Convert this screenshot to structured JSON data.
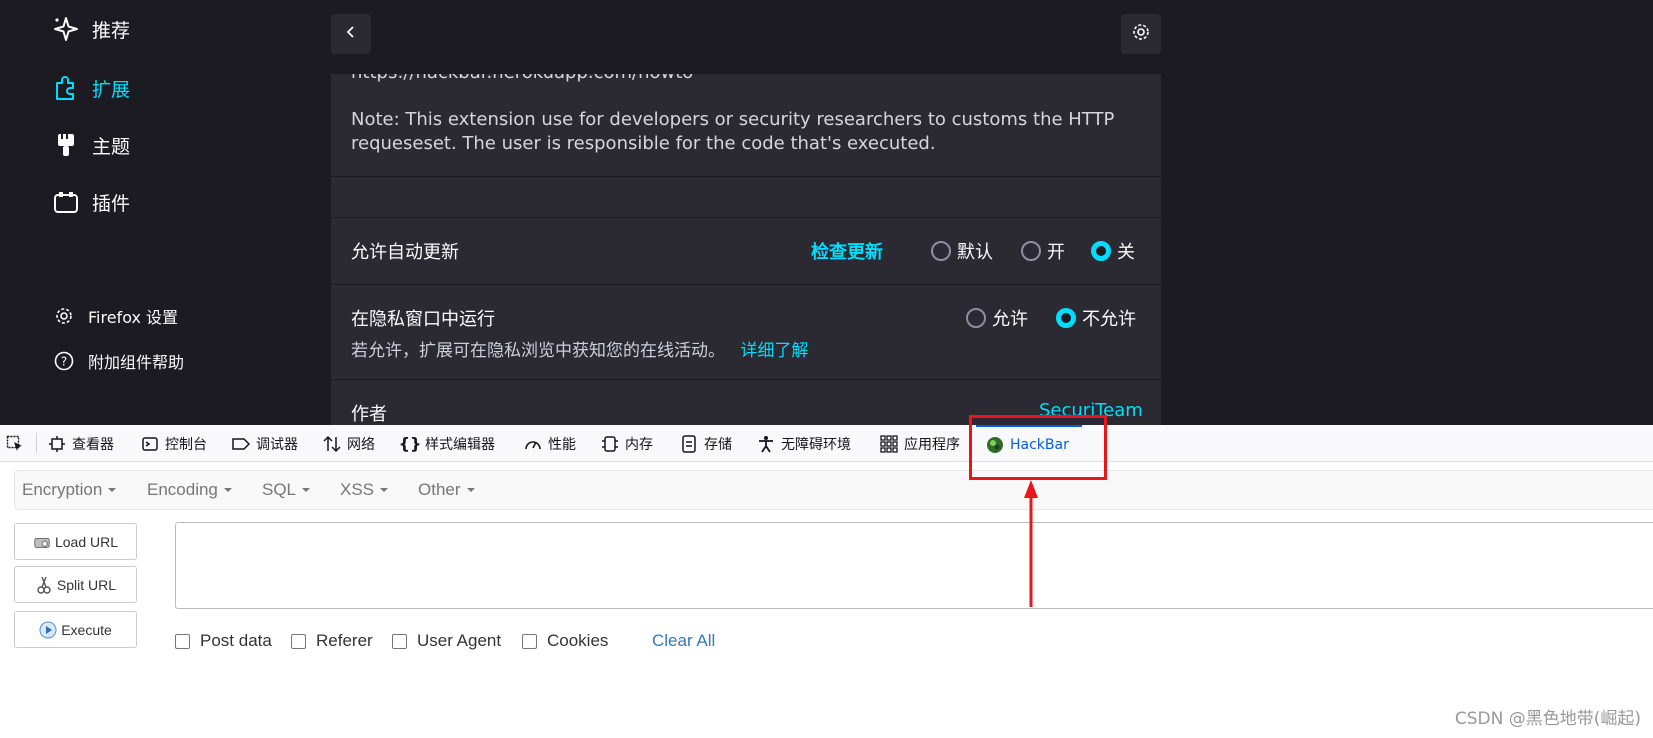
{
  "sidebar": {
    "items": [
      {
        "label": "推荐",
        "icon": "sparkle-icon"
      },
      {
        "label": "扩展",
        "icon": "puzzle-icon",
        "active": true
      },
      {
        "label": "主题",
        "icon": "brush-icon"
      },
      {
        "label": "插件",
        "icon": "plugin-icon"
      }
    ],
    "footer": [
      {
        "label": "Firefox 设置",
        "icon": "gear-icon"
      },
      {
        "label": "附加组件帮助",
        "icon": "help-icon"
      }
    ]
  },
  "addon_detail": {
    "homepage_url": "https://hackbar.herokuapp.com/howto",
    "note": "Note: This extension use for developers or security researchers to customs the HTTP requeseset. The user is responsible for the code that's executed.",
    "auto_update": {
      "label": "允许自动更新",
      "check_link": "检查更新",
      "options": [
        "默认",
        "开",
        "关"
      ],
      "selected": "关"
    },
    "private": {
      "label": "在隐私窗口中运行",
      "description": "若允许，扩展可在隐私浏览中获知您的在线活动。",
      "learn_more": "详细了解",
      "options": [
        "允许",
        "不允许"
      ],
      "selected": "不允许"
    },
    "author": {
      "label": "作者",
      "value": "SecuriTeam"
    }
  },
  "devtools": {
    "tabs": [
      {
        "label": "查看器",
        "icon": "inspector-icon"
      },
      {
        "label": "控制台",
        "icon": "console-icon"
      },
      {
        "label": "调试器",
        "icon": "debugger-icon"
      },
      {
        "label": "网络",
        "icon": "network-icon"
      },
      {
        "label": "样式编辑器",
        "icon": "style-editor-icon"
      },
      {
        "label": "性能",
        "icon": "performance-icon"
      },
      {
        "label": "内存",
        "icon": "memory-icon"
      },
      {
        "label": "存储",
        "icon": "storage-icon"
      },
      {
        "label": "无障碍环境",
        "icon": "accessibility-icon"
      },
      {
        "label": "应用程序",
        "icon": "application-icon"
      },
      {
        "label": "HackBar",
        "icon": "hackbar-icon",
        "selected": true
      }
    ]
  },
  "hackbar": {
    "menu": [
      "Encryption",
      "Encoding",
      "SQL",
      "XSS",
      "Other"
    ],
    "buttons": [
      "Load URL",
      "Split URL",
      "Execute"
    ],
    "url_value": "",
    "options": [
      "Post data",
      "Referer",
      "User Agent",
      "Cookies"
    ],
    "clear_all": "Clear All"
  },
  "watermark": "CSDN @黑色地带(崛起)",
  "colors": {
    "dark_bg": "#1c1b22",
    "panel_bg": "#2b2a33",
    "accent": "#00ddff",
    "annotation": "#e8151b",
    "link_blue": "#337ab7"
  }
}
